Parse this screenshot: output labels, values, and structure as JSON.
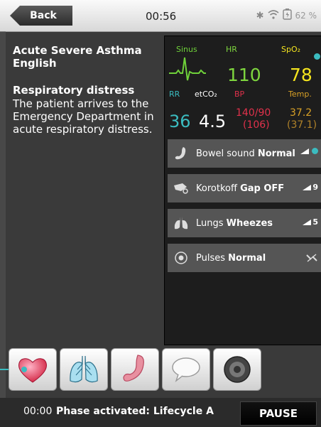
{
  "header": {
    "back_label": "Back",
    "time": "00:56",
    "battery_pct": "62 %"
  },
  "case": {
    "title": "Acute Severe Asthma",
    "language": "English",
    "phase_title": "Respiratory distress",
    "phase_description": "The patient arrives to the Emergency Department in acute respiratory distress."
  },
  "monitor": {
    "rhythm_label": "Sinus",
    "hr_label": "HR",
    "hr_value": "110",
    "spo2_label": "SpO₂",
    "spo2_value": "78",
    "rr_label": "RR",
    "rr_value": "36",
    "etco2_label": "etCO₂",
    "etco2_value": "4.5",
    "bp_label": "BP",
    "bp_value": "140/90",
    "bp_mean": "(106)",
    "temp_label": "Temp.",
    "temp_value": "37.2",
    "temp_secondary": "(37.1)",
    "colors": {
      "rhythm": "#6fd13a",
      "hr": "#7ed63e",
      "spo2": "#f4e41e",
      "rr": "#3bbcc0",
      "etco2": "#ffffff",
      "bp": "#e0314b",
      "temp": "#d9a126"
    }
  },
  "controls": [
    {
      "name_prefix": "Bowel sound",
      "value": "Normal",
      "volume": "",
      "icon": "stomach-icon"
    },
    {
      "name_prefix": "Korotkoff",
      "value": "Gap OFF",
      "volume": "9",
      "icon": "bp-cuff-icon"
    },
    {
      "name_prefix": "Lungs",
      "value": "Wheezes",
      "volume": "5",
      "icon": "lungs-icon"
    },
    {
      "name_prefix": "Pulses",
      "value": "Normal",
      "volume": "",
      "icon": "pulse-icon"
    }
  ],
  "tabs": [
    {
      "name": "heart",
      "icon": "heart-icon"
    },
    {
      "name": "lungs",
      "icon": "lungs-icon"
    },
    {
      "name": "bowel",
      "icon": "stomach-icon"
    },
    {
      "name": "speech",
      "icon": "speech-bubble-icon"
    },
    {
      "name": "sound",
      "icon": "speaker-icon"
    }
  ],
  "footer": {
    "time": "00:00",
    "status": "Phase activated: Lifecycle A",
    "pause_label": "PAUSE"
  }
}
